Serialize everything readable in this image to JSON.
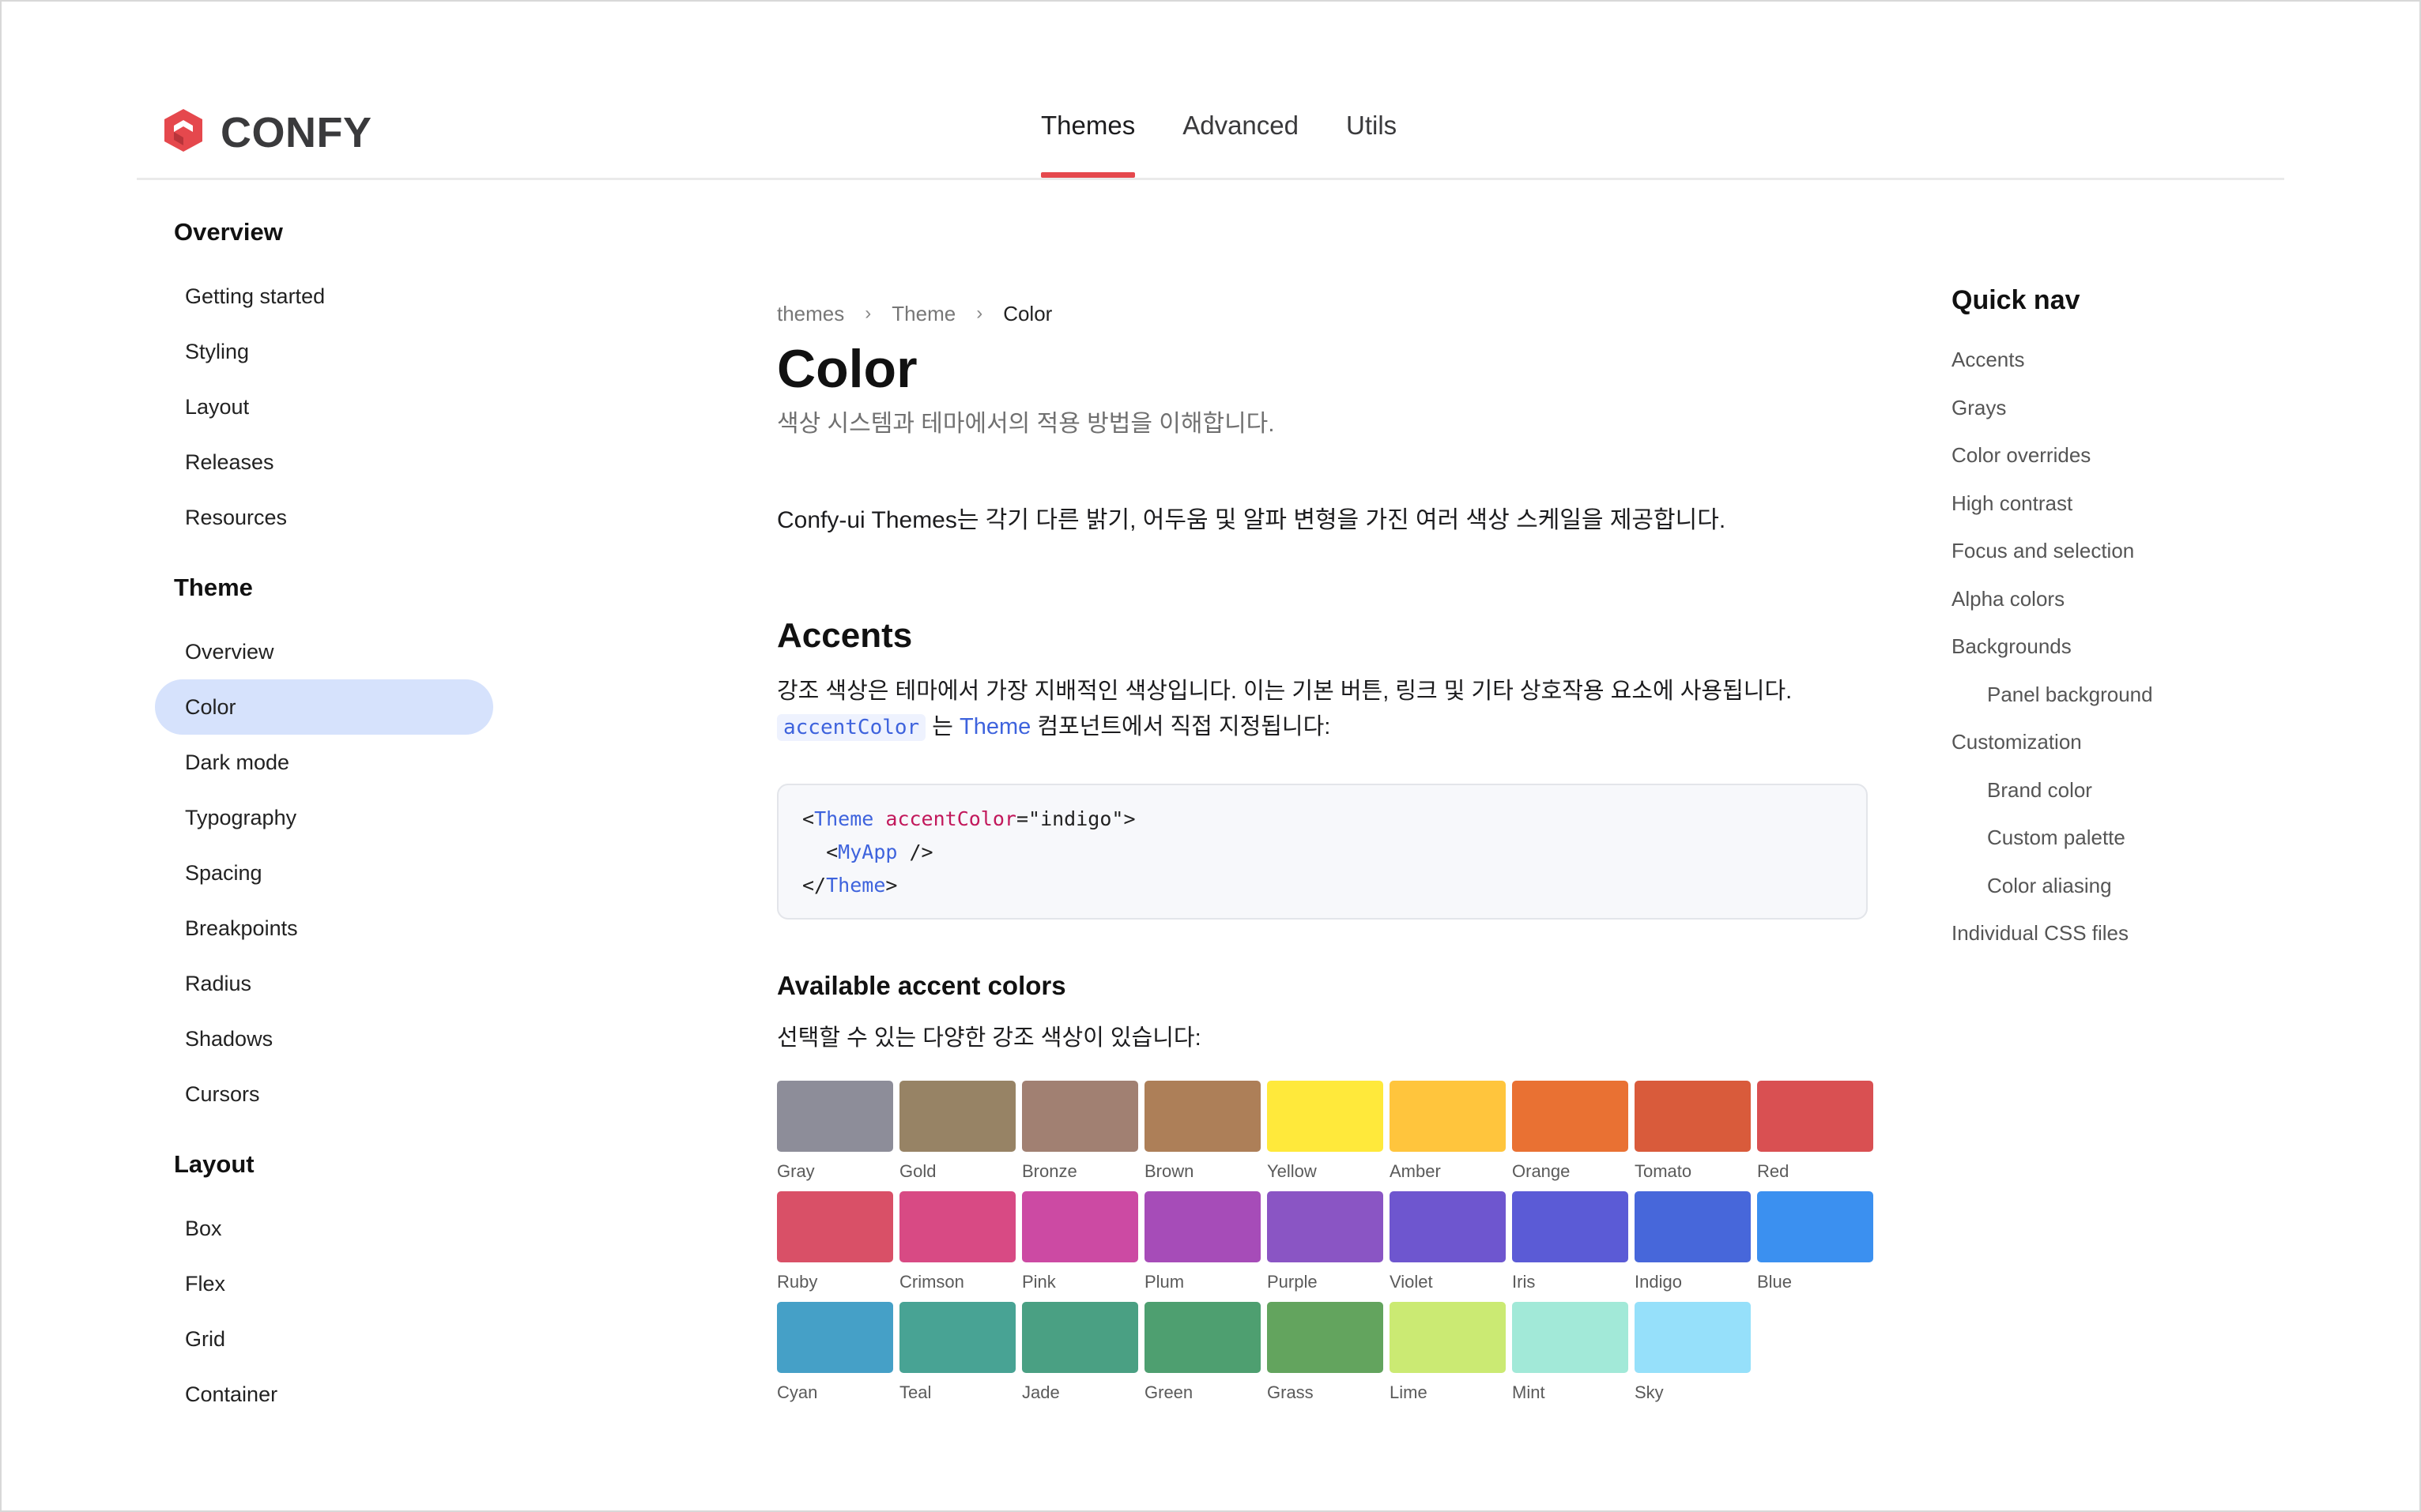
{
  "brand": {
    "name": "CONFY",
    "logo_color": "#e5484d"
  },
  "topnav": {
    "tabs": [
      {
        "label": "Themes",
        "active": true
      },
      {
        "label": "Advanced"
      },
      {
        "label": "Utils"
      }
    ]
  },
  "sidebar": {
    "groups": [
      {
        "title": "Overview",
        "items": [
          "Getting started",
          "Styling",
          "Layout",
          "Releases",
          "Resources"
        ]
      },
      {
        "title": "Theme",
        "items": [
          "Overview",
          "Color",
          "Dark mode",
          "Typography",
          "Spacing",
          "Breakpoints",
          "Radius",
          "Shadows",
          "Cursors"
        ],
        "active_index": 1
      },
      {
        "title": "Layout",
        "items": [
          "Box",
          "Flex",
          "Grid",
          "Container"
        ]
      }
    ]
  },
  "breadcrumb": {
    "items": [
      "themes",
      "Theme",
      "Color"
    ]
  },
  "page": {
    "title": "Color",
    "subtitle": "색상 시스템과 테마에서의 적용 방법을 이해합니다.",
    "intro": "Confy-ui Themes는 각기 다른 밝기, 어두움 및 알파 변형을 가진 여러 색상 스케일을 제공합니다."
  },
  "accents": {
    "heading": "Accents",
    "para_line1": "강조 색상은 테마에서 가장 지배적인 색상입니다. 이는 기본 버튼, 링크 및 기타 상호작용 요소에 사용됩니다.",
    "code_inline": "accentColor",
    "para_mid": "는",
    "para_link": "Theme",
    "para_end": "컴포넌트에서 직접 지정됩니다:",
    "code": {
      "line1": {
        "open": "<",
        "tag": "Theme",
        "attr": "accentColor",
        "eq": "=",
        "val": "\"indigo\"",
        "close": ">"
      },
      "line2": {
        "open": "<",
        "tag": "MyApp",
        "close": " />"
      },
      "line3": {
        "open": "</",
        "tag": "Theme",
        "close": ">"
      }
    }
  },
  "available": {
    "heading": "Available accent colors",
    "description": "선택할 수 있는 다양한 강조 색상이 있습니다:",
    "swatches": [
      {
        "name": "Gray",
        "color": "#8d8d99"
      },
      {
        "name": "Gold",
        "color": "#978365"
      },
      {
        "name": "Bronze",
        "color": "#a18072"
      },
      {
        "name": "Brown",
        "color": "#ad7f58"
      },
      {
        "name": "Yellow",
        "color": "#ffe93b"
      },
      {
        "name": "Amber",
        "color": "#ffc53d"
      },
      {
        "name": "Orange",
        "color": "#e97133"
      },
      {
        "name": "Tomato",
        "color": "#d95b3b"
      },
      {
        "name": "Red",
        "color": "#d95052"
      },
      {
        "name": "Ruby",
        "color": "#d95067"
      },
      {
        "name": "Crimson",
        "color": "#d84a84"
      },
      {
        "name": "Pink",
        "color": "#cc4aa3"
      },
      {
        "name": "Plum",
        "color": "#a64cb8"
      },
      {
        "name": "Purple",
        "color": "#8a55c4"
      },
      {
        "name": "Violet",
        "color": "#6e56cf"
      },
      {
        "name": "Iris",
        "color": "#5b5bd6"
      },
      {
        "name": "Indigo",
        "color": "#4767da"
      },
      {
        "name": "Blue",
        "color": "#3b90f0"
      },
      {
        "name": "Cyan",
        "color": "#45a0c7"
      },
      {
        "name": "Teal",
        "color": "#48a394"
      },
      {
        "name": "Jade",
        "color": "#4aa083"
      },
      {
        "name": "Green",
        "color": "#4e9f70"
      },
      {
        "name": "Grass",
        "color": "#63a45e"
      },
      {
        "name": "Lime",
        "color": "#cbea73"
      },
      {
        "name": "Mint",
        "color": "#a2e9d8"
      },
      {
        "name": "Sky",
        "color": "#96e0fa"
      }
    ]
  },
  "quicknav": {
    "title": "Quick nav",
    "items": [
      {
        "label": "Accents"
      },
      {
        "label": "Grays"
      },
      {
        "label": "Color overrides"
      },
      {
        "label": "High contrast"
      },
      {
        "label": "Focus and selection"
      },
      {
        "label": "Alpha colors"
      },
      {
        "label": "Backgrounds"
      },
      {
        "label": "Panel background",
        "sub": true
      },
      {
        "label": "Customization"
      },
      {
        "label": "Brand color",
        "sub": true
      },
      {
        "label": "Custom palette",
        "sub": true
      },
      {
        "label": "Color aliasing",
        "sub": true
      },
      {
        "label": "Individual CSS files"
      }
    ]
  }
}
